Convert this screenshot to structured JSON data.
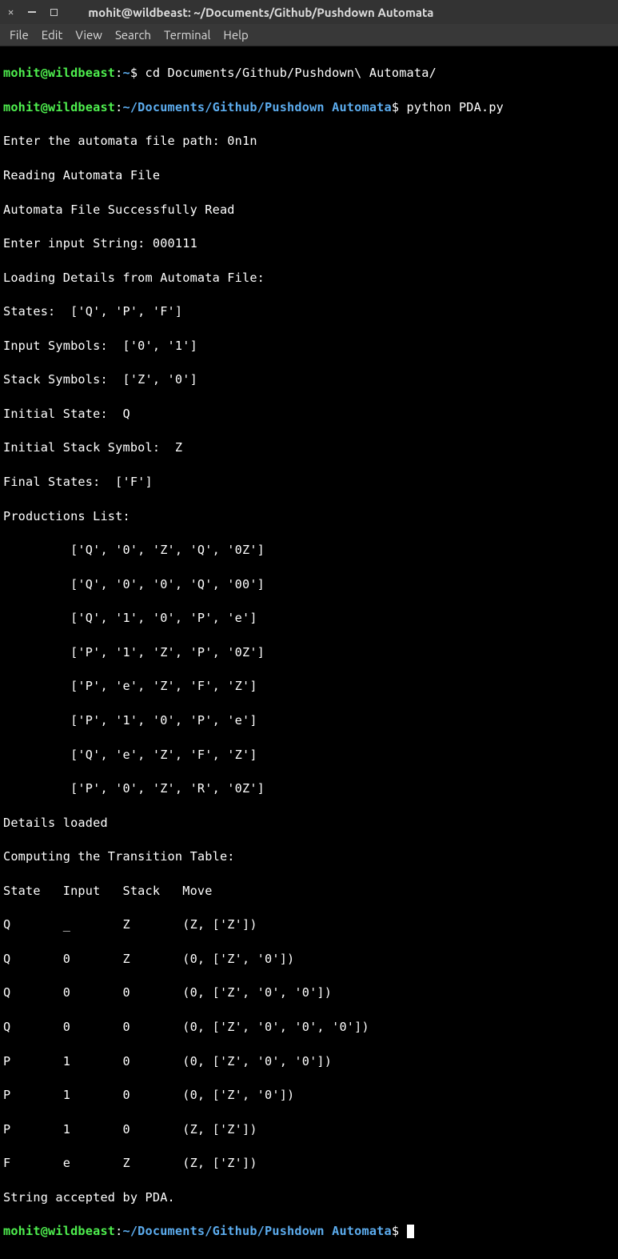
{
  "window": {
    "title": "mohit@wildbeast: ~/Documents/Github/Pushdown Automata"
  },
  "menu": {
    "file": "File",
    "edit": "Edit",
    "view": "View",
    "search": "Search",
    "terminal": "Terminal",
    "help": "Help"
  },
  "prompt1": {
    "user": "mohit@wildbeast",
    "colon": ":",
    "path": "~",
    "dollar": "$",
    "cmd": " cd Documents/Github/Pushdown\\ Automata/"
  },
  "prompt2": {
    "user": "mohit@wildbeast",
    "colon": ":",
    "path": "~/Documents/Github/Pushdown Automata",
    "dollar": "$",
    "cmd": " python PDA.py"
  },
  "output": {
    "l1": "Enter the automata file path: 0n1n",
    "l2": "Reading Automata File",
    "l3": "Automata File Successfully Read",
    "l4": "Enter input String: 000111",
    "l5": "Loading Details from Automata File:",
    "l6": "States:  ['Q', 'P', 'F']",
    "l7": "Input Symbols:  ['0', '1']",
    "l8": "Stack Symbols:  ['Z', '0']",
    "l9": "Initial State:  Q",
    "l10": "Initial Stack Symbol:  Z",
    "l11": "Final States:  ['F']",
    "l12": "Productions List:",
    "l13": "         ['Q', '0', 'Z', 'Q', '0Z']",
    "l14": "         ['Q', '0', '0', 'Q', '00']",
    "l15": "         ['Q', '1', '0', 'P', 'e']",
    "l16": "         ['P', '1', 'Z', 'P', '0Z']",
    "l17": "         ['P', 'e', 'Z', 'F', 'Z']",
    "l18": "         ['P', '1', '0', 'P', 'e']",
    "l19": "         ['Q', 'e', 'Z', 'F', 'Z']",
    "l20": "         ['P', '0', 'Z', 'R', '0Z']",
    "l21": "Details loaded",
    "l22": "Computing the Transition Table:",
    "l23": "State   Input   Stack   Move",
    "l24": "Q       _       Z       (Z, ['Z'])",
    "l25": "Q       0       Z       (0, ['Z', '0'])",
    "l26": "Q       0       0       (0, ['Z', '0', '0'])",
    "l27": "Q       0       0       (0, ['Z', '0', '0', '0'])",
    "l28": "P       1       0       (0, ['Z', '0', '0'])",
    "l29": "P       1       0       (0, ['Z', '0'])",
    "l30": "P       1       0       (Z, ['Z'])",
    "l31": "F       e       Z       (Z, ['Z'])",
    "l32": "String accepted by PDA."
  },
  "prompt3": {
    "user": "mohit@wildbeast",
    "colon": ":",
    "path": "~/Documents/Github/Pushdown Automata",
    "dollar": "$",
    "cmd": " "
  }
}
